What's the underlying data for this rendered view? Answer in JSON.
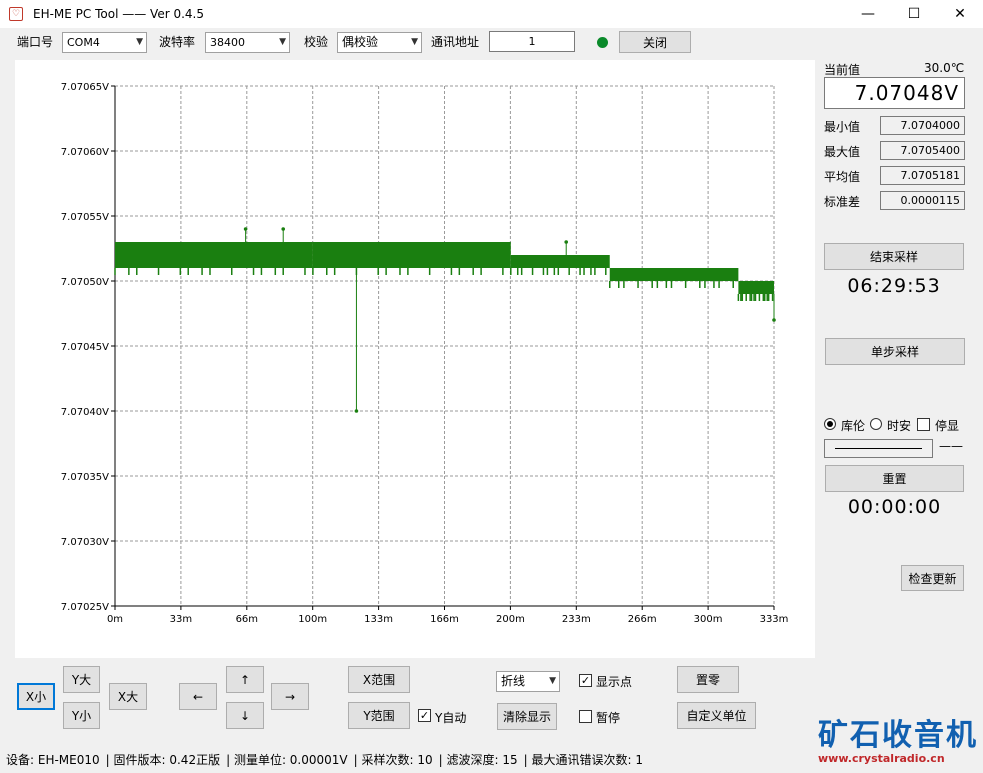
{
  "window": {
    "title": "EH-ME PC Tool  ——  Ver 0.4.5",
    "minimize": "—",
    "maximize": "☐",
    "close": "✕"
  },
  "toolbar": {
    "port_label": "端口号",
    "port_value": "COM4",
    "baud_label": "波特率",
    "baud_value": "38400",
    "parity_label": "校验",
    "parity_value": "偶校验",
    "addr_label": "通讯地址",
    "addr_value": "1",
    "close_button": "关闭",
    "led_color": "#0a8a2a"
  },
  "chart_data": {
    "type": "line",
    "color": "#1a7f10",
    "x_unit": "m",
    "xlim": [
      0,
      333
    ],
    "ylim": [
      7.07025,
      7.07065
    ],
    "x_ticks": [
      "0m",
      "33m",
      "66m",
      "100m",
      "133m",
      "166m",
      "200m",
      "233m",
      "266m",
      "300m",
      "333m"
    ],
    "y_ticks": [
      "7.07065V",
      "7.07060V",
      "7.07055V",
      "7.07050V",
      "7.07045V",
      "7.07040V",
      "7.07035V",
      "7.07030V",
      "7.07025V"
    ],
    "grid": true,
    "show_points": true,
    "segments": [
      {
        "x0": 0,
        "x1": 100,
        "hi": 7.07053,
        "lo": 7.07051
      },
      {
        "x0": 100,
        "x1": 200,
        "hi": 7.07053,
        "lo": 7.07051
      },
      {
        "x0": 200,
        "x1": 250,
        "hi": 7.07052,
        "lo": 7.07051
      },
      {
        "x0": 250,
        "x1": 315,
        "hi": 7.07051,
        "lo": 7.0705
      },
      {
        "x0": 315,
        "x1": 333,
        "hi": 7.0705,
        "lo": 7.07049
      }
    ],
    "spikes": [
      {
        "x": 66,
        "y": 7.07054
      },
      {
        "x": 85,
        "y": 7.07054
      },
      {
        "x": 122,
        "y": 7.0704
      },
      {
        "x": 228,
        "y": 7.07053
      },
      {
        "x": 333,
        "y": 7.07047
      }
    ]
  },
  "panel": {
    "current_label": "当前值",
    "temperature": "30.0℃",
    "current_value": "7.07048V",
    "min_label": "最小值",
    "min_value": "7.0704000",
    "max_label": "最大值",
    "max_value": "7.0705400",
    "avg_label": "平均值",
    "avg_value": "7.0705181",
    "std_label": "标准差",
    "std_value": "0.0000115",
    "stop_button": "结束采样",
    "elapsed": "06:29:53",
    "single_button": "单步采样",
    "radio_coulomb": "库伦",
    "radio_ampere_hour": "时安",
    "check_stop": "停显",
    "dash": "——",
    "reset_button": "重置",
    "counter": "00:00:00",
    "update_button": "检查更新"
  },
  "controls": {
    "x_small": "X小",
    "y_large": "Y大",
    "y_small": "Y小",
    "x_large": "X大",
    "left": "←",
    "up": "↑",
    "down": "↓",
    "right": "→",
    "x_range": "X范围",
    "y_range": "Y范围",
    "y_auto": "Y自动",
    "chart_mode": "折线",
    "clear": "清除显示",
    "show_points": "显示点",
    "pause": "暂停",
    "zero": "置零",
    "custom_unit": "自定义单位"
  },
  "status": {
    "device": "设备: EH-ME010",
    "firmware": "固件版本: 0.42正版",
    "unit": "测量单位:      0.00001V",
    "samples": "采样次数:   10",
    "filter": "滤波深度:   15",
    "max_err": "最大通讯错误次数:   1"
  },
  "logo": {
    "text": "矿石收音机",
    "url": "www.crystalradio.cn"
  }
}
